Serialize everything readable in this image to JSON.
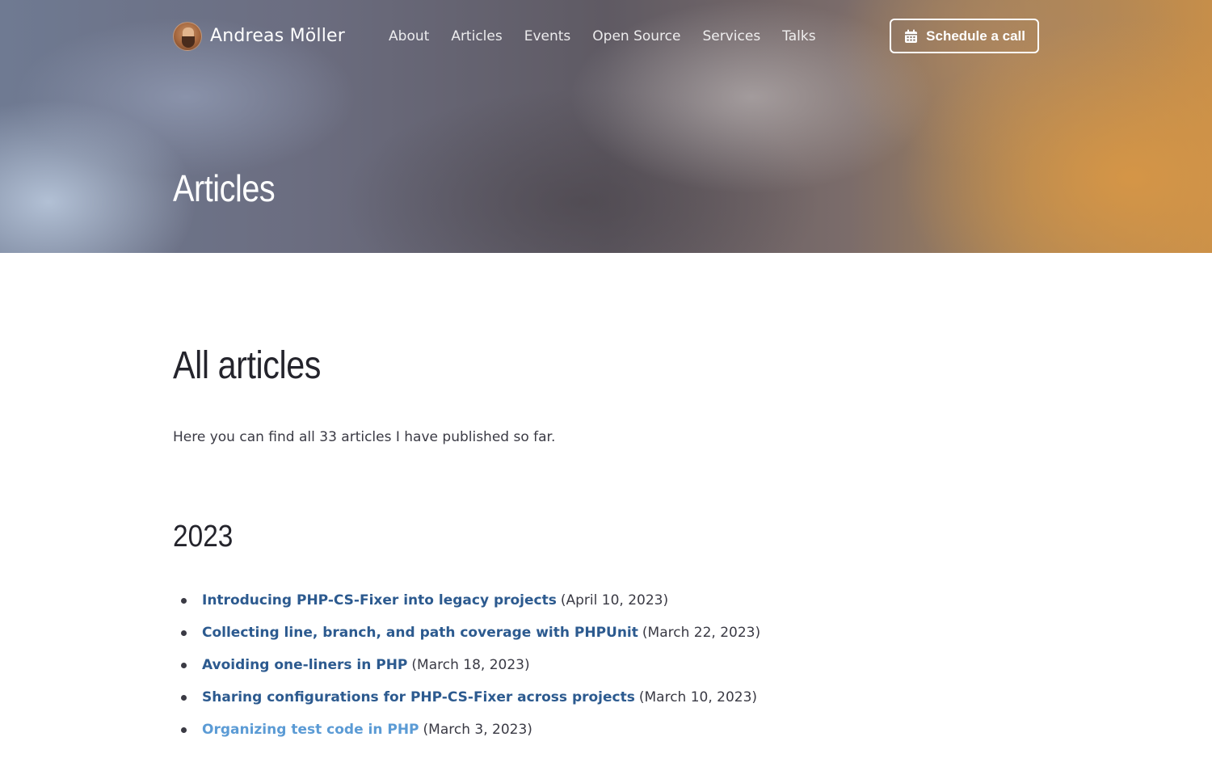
{
  "header": {
    "brand_name": "Andreas Möller",
    "nav": [
      "About",
      "Articles",
      "Events",
      "Open Source",
      "Services",
      "Talks"
    ],
    "cta_label": "Schedule a call",
    "hero_title": "Articles"
  },
  "main": {
    "title": "All articles",
    "intro": "Here you can find all 33 articles I have published so far.",
    "groups": [
      {
        "year": "2023",
        "articles": [
          {
            "title": "Introducing PHP-CS-Fixer into legacy projects",
            "date": "(April 10, 2023)"
          },
          {
            "title": "Collecting line, branch, and path coverage with PHPUnit",
            "date": "(March 22, 2023)"
          },
          {
            "title": "Avoiding one-liners in PHP",
            "date": "(March 18, 2023)"
          },
          {
            "title": "Sharing configurations for PHP-CS-Fixer across projects",
            "date": "(March 10, 2023)"
          },
          {
            "title": "Organizing test code in PHP",
            "date": "(March 3, 2023)"
          }
        ]
      }
    ]
  },
  "colors": {
    "link": "#2c5a8f",
    "link_hover": "#5b9bd5",
    "text": "#3a3a44",
    "heading": "#24242c"
  },
  "icons": {
    "cta": "calendar-icon",
    "list_marker": "bullet"
  }
}
